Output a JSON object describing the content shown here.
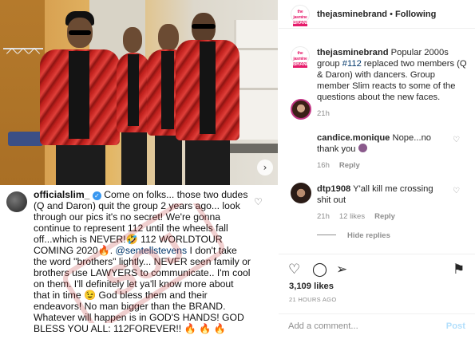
{
  "photo": {
    "alt": "Four men in matching red jackets standing in a dressing room",
    "next_icon": "chevron-right-icon",
    "next_glyph": "›"
  },
  "embedded_caption": {
    "username": "officialslim_",
    "verified_glyph": "✓",
    "line_1": " Come on folks... those two dudes (Q and Daron) quit the group 2 years ago... look through our pics it's no secret! We're gonna continue to represent 112 until the wheels fall off...which is NEVER!🤣 112 WORLDTOUR COMING 2020🔥. ",
    "mention": "@sentellstevens",
    "line_2": " I don't take the word \"brothers\" lightly... NEVER seen family or brothers use LAWYERS to communicate.. I'm cool on them. I'll definitely let ya'll know more about that in time 😉 God bless them and their endeavors! No man bigger than the BRAND. Whatever will happen is in GOD'S HANDS! GOD BLESS YOU ALL: 112FOREVER!! 🔥 🔥 🔥",
    "heart_glyph": "♡",
    "watermark": "SOJ"
  },
  "header": {
    "logo_line1": "the",
    "logo_line2": "jasmine",
    "logo_line3": "BRAND",
    "username": "thejasminebrand",
    "separator": " • ",
    "follow_label": "Following"
  },
  "caption": {
    "username": "thejasminebrand",
    "text_before": " Popular 2000s group ",
    "hashtag": "#112",
    "text_after": " replaced two members (Q & Daron) with dancers. Group member Slim reacts to some of the questions about the new faces.",
    "time": "21h"
  },
  "comments": [
    {
      "username": "candice.monique",
      "text": " Nope...no thank you ",
      "time": "16h",
      "reply_label": "Reply",
      "heart_glyph": "♡"
    },
    {
      "username": "dtp1908",
      "text": " Y'all kill me crossing shit out",
      "time": "21h",
      "likes": "12 likes",
      "reply_label": "Reply",
      "heart_glyph": "♡"
    }
  ],
  "hide_replies_label": "Hide replies",
  "actions": {
    "like_glyph": "♡",
    "comment_glyph": "◯",
    "share_glyph": "➢",
    "save_glyph": "⚑",
    "likes": "3,109 likes",
    "ago": "21 HOURS AGO"
  },
  "add_comment": {
    "placeholder": "Add a comment...",
    "post_label": "Post"
  },
  "colors": {
    "brand_pink": "#e61c6b",
    "link_blue": "#00376b",
    "post_disabled": "#b2dffc",
    "verified_blue": "#3897f0"
  }
}
